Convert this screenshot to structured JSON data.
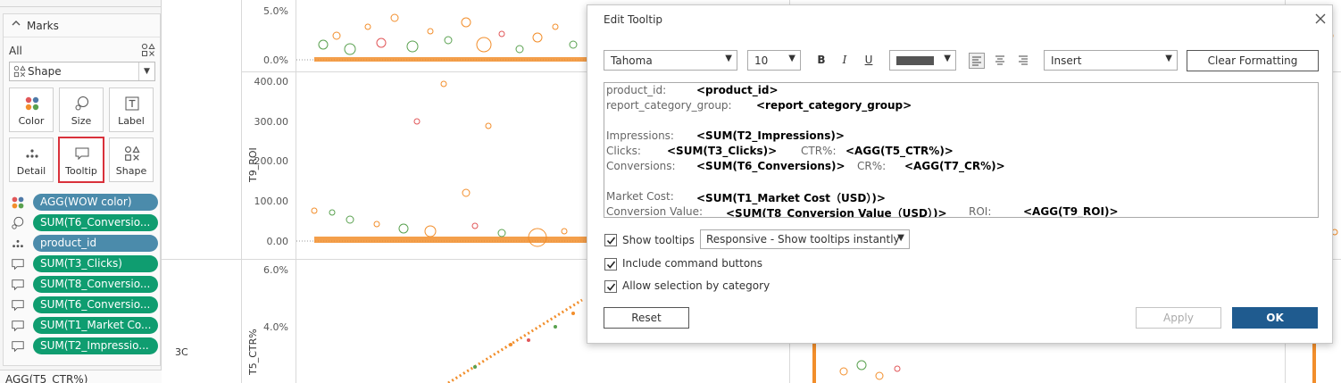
{
  "marks_panel": {
    "title": "Marks",
    "all_label": "All",
    "mark_type": "Shape",
    "buttons": [
      {
        "label": "Color",
        "icon": "color-dots-icon"
      },
      {
        "label": "Size",
        "icon": "size-icon"
      },
      {
        "label": "Label",
        "icon": "label-icon"
      },
      {
        "label": "Detail",
        "icon": "detail-icon"
      },
      {
        "label": "Tooltip",
        "icon": "tooltip-icon"
      },
      {
        "label": "Shape",
        "icon": "shape-icon"
      }
    ],
    "pills": [
      {
        "label": "AGG(WOW color)",
        "icon": "color-dots-icon"
      },
      {
        "label": "SUM(T6_Conversio...",
        "icon": "size-icon"
      },
      {
        "label": "product_id",
        "icon": "detail-icon"
      },
      {
        "label": "SUM(T3_Clicks)",
        "icon": "tooltip-icon"
      },
      {
        "label": "SUM(T8_Conversio...",
        "icon": "tooltip-icon"
      },
      {
        "label": "SUM(T6_Conversio...",
        "icon": "tooltip-icon"
      },
      {
        "label": "SUM(T1_Market Co...",
        "icon": "tooltip-icon"
      },
      {
        "label": "SUM(T2_Impressio...",
        "icon": "tooltip-icon"
      }
    ],
    "next_card_label": "AGG(T5_CTR%)"
  },
  "view": {
    "row_label": "3C",
    "axis_roi_title": "T9_ROI",
    "axis_ctr_title": "T5_CTR%",
    "ticks_top": [
      "5.0%",
      "0.0%"
    ],
    "ticks_roi": [
      "400.00",
      "300.00",
      "200.00",
      "100.00",
      "0.00"
    ],
    "ticks_ctr": [
      "6.0%",
      "4.0%"
    ]
  },
  "dialog": {
    "title": "Edit Tooltip",
    "font_family": "Tahoma",
    "font_size": "10",
    "bold": "B",
    "italic": "I",
    "underline": "U",
    "insert_label": "Insert",
    "clear_formatting": "Clear Formatting",
    "tooltip_lines": {
      "product_id_label": "product_id:",
      "product_id_field": "<product_id>",
      "rcg_label": "report_category_group:",
      "rcg_field": "<report_category_group>",
      "impressions_label": "Impressions:",
      "impressions_field": "<SUM(T2_Impressions)>",
      "clicks_label": "Clicks:",
      "clicks_field": "<SUM(T3_Clicks)>",
      "ctr_label": "CTR%:",
      "ctr_field": "<AGG(T5_CTR%)>",
      "conversions_label": "Conversions:",
      "conversions_field": "<SUM(T6_Conversions)>",
      "cr_label": "CR%:",
      "cr_field": "<AGG(T7_CR%)>",
      "market_cost_label": "Market Cost:",
      "market_cost_field": "<SUM(T1_Market Cost（USD）)>",
      "conv_value_label": "Conversion Value:",
      "conv_value_field": "<SUM(T8_Conversion Value（USD）)>",
      "roi_label": "ROI:",
      "roi_field": "<AGG(T9_ROI)>"
    },
    "show_tooltips_label": "Show tooltips",
    "show_tooltips_mode": "Responsive - Show tooltips instantly",
    "include_command_buttons_label": "Include command buttons",
    "allow_selection_label": "Allow selection by category",
    "reset_label": "Reset",
    "apply_label": "Apply",
    "ok_label": "OK"
  }
}
